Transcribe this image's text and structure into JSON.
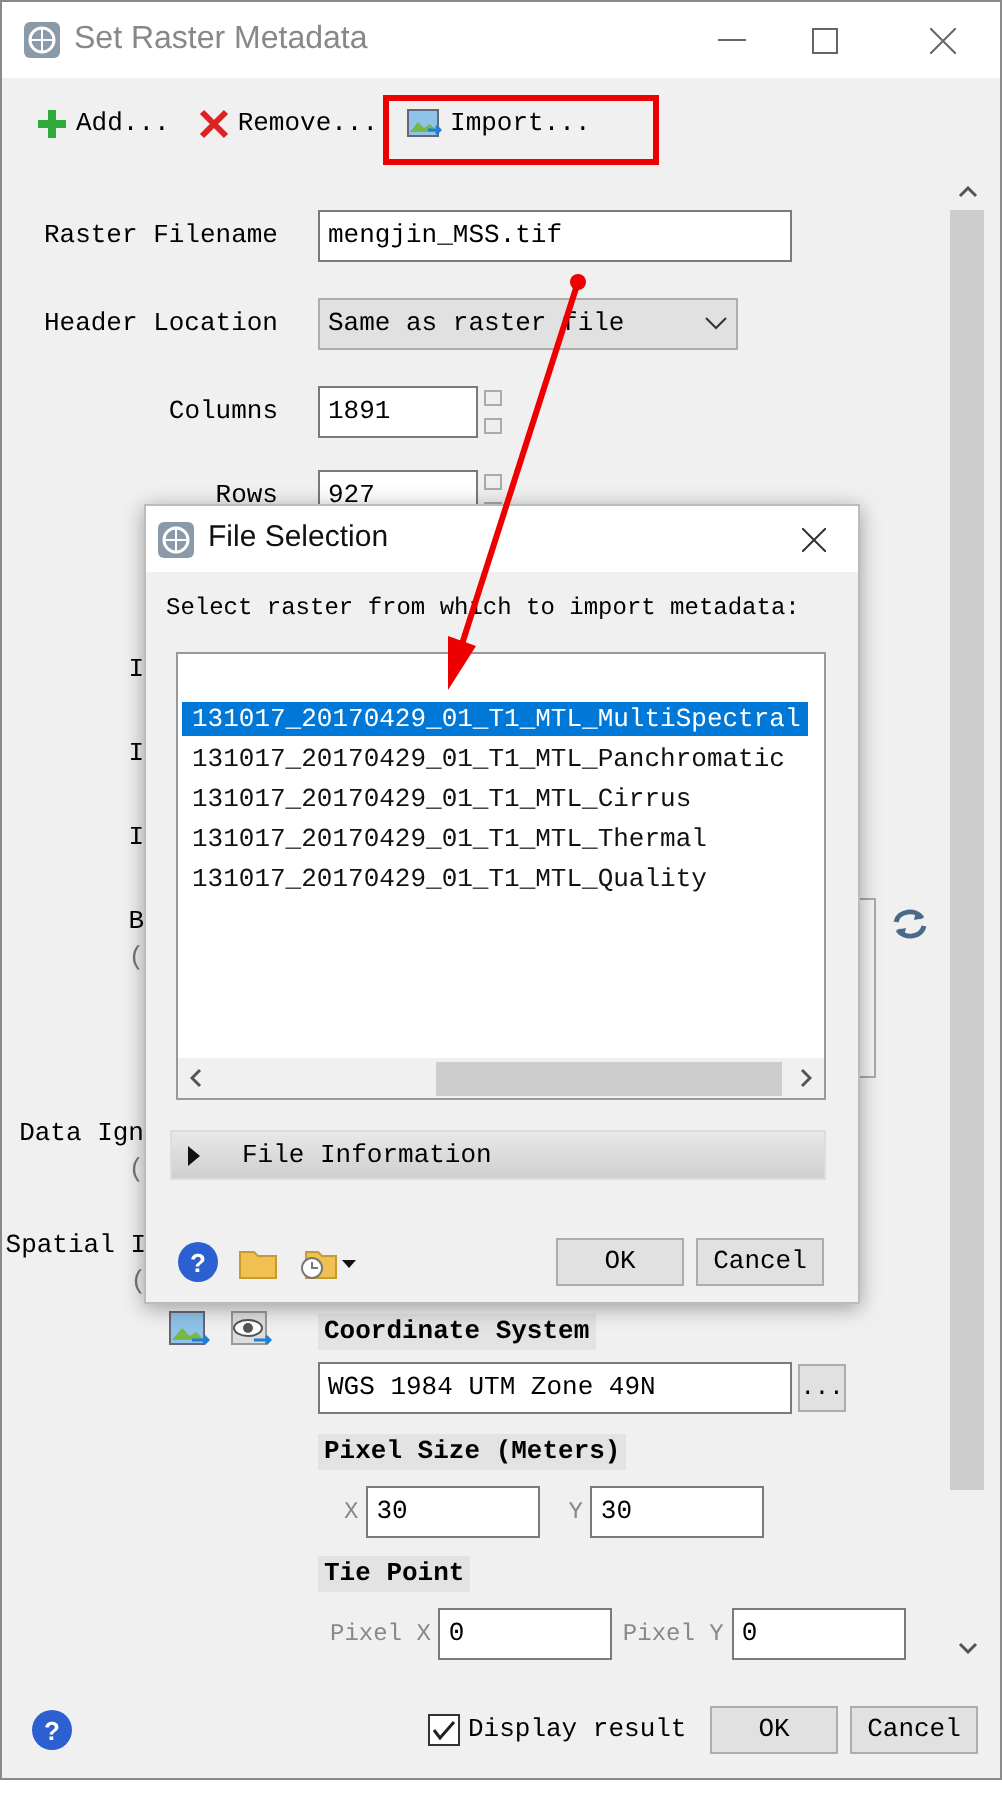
{
  "window": {
    "title": "Set Raster Metadata"
  },
  "toolbar": [
    {
      "kind": "add",
      "label": "Add..."
    },
    {
      "kind": "remove",
      "label": "Remove..."
    },
    {
      "kind": "import",
      "label": "Import..."
    }
  ],
  "fields": [
    {
      "kind": "text",
      "label": "Raster Filename",
      "value": "mengjin_MSS.tif"
    },
    {
      "kind": "select",
      "label": "Header Location",
      "value": "Same as raster file"
    },
    {
      "kind": "spin",
      "label": "Columns",
      "value": "1891"
    },
    {
      "kind": "spin",
      "label": "Rows",
      "value": "927"
    },
    {
      "kind": "partial",
      "label": "I"
    },
    {
      "kind": "partial",
      "label": "I"
    },
    {
      "kind": "partial",
      "label": "I"
    },
    {
      "kind": "list",
      "label": "B",
      "note": "("
    },
    {
      "kind": "partial",
      "label": "Data Ign",
      "note": "("
    }
  ],
  "spatial": {
    "label": "Spatial I",
    "note": "(",
    "coordinate_label": "Coordinate System",
    "coordinate_value": "WGS 1984 UTM Zone 49N",
    "browse": "...",
    "pixel_size_label": "Pixel Size (Meters)",
    "x_label": "X",
    "x_value": "30",
    "y_label": "Y",
    "y_value": "30",
    "tie_label": "Tie Point",
    "px_label": "Pixel X",
    "px_value": "0",
    "py_label": "Pixel Y",
    "py_value": "0"
  },
  "footer": {
    "help": "?",
    "display_result": {
      "label": "Display result",
      "checked": true
    },
    "buttons": [
      "OK",
      "Cancel"
    ]
  },
  "dialog": {
    "title": "File Selection",
    "prompt": "Select raster from which to import metadata:",
    "items": [
      {
        "label": "131017_20170429_01_T1_MTL_MultiSpectral",
        "selected": true
      },
      {
        "label": "131017_20170429_01_T1_MTL_Panchromatic",
        "selected": false
      },
      {
        "label": "131017_20170429_01_T1_MTL_Cirrus",
        "selected": false
      },
      {
        "label": "131017_20170429_01_T1_MTL_Thermal",
        "selected": false
      },
      {
        "label": "131017_20170429_01_T1_MTL_Quality",
        "selected": false
      }
    ],
    "section": {
      "label": "File Information",
      "expanded": false
    },
    "help": "?",
    "buttons": [
      "OK",
      "Cancel"
    ]
  }
}
